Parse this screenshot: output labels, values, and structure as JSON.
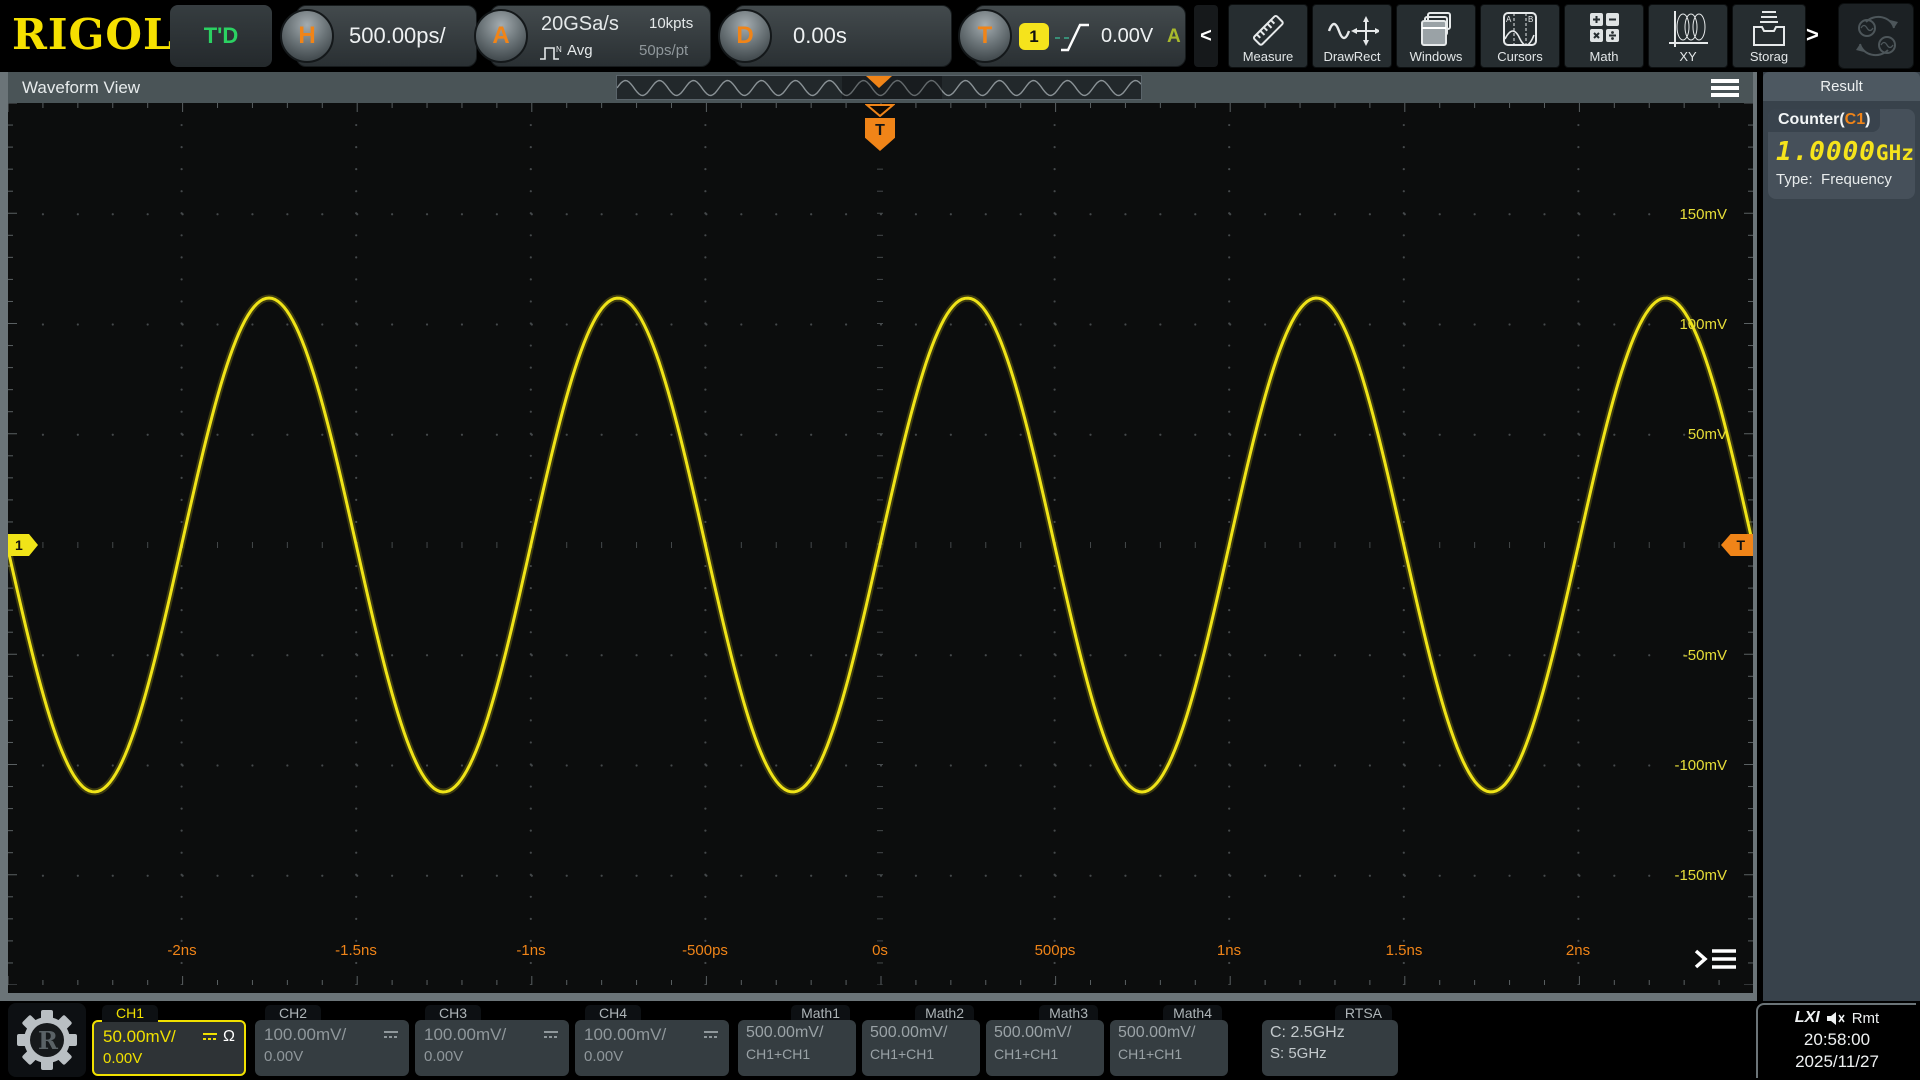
{
  "top_bar": {
    "logo": "RIGOL",
    "trigger_status": "T'D",
    "horizontal": {
      "knob": "H",
      "scale": "500.00ps/"
    },
    "acquire": {
      "knob": "A",
      "sample_rate": "20GSa/s",
      "mem_depth": "10kpts",
      "mode": "Avg",
      "resolution": "50ps/pt"
    },
    "delay": {
      "knob": "D",
      "value": "0.00s"
    },
    "trigger": {
      "knob": "T",
      "source": "1",
      "level": "0.00V",
      "sweep": "A"
    },
    "collapse_left": "<",
    "scroll_right": ">",
    "toolbar": [
      {
        "label": "Measure"
      },
      {
        "label": "DrawRect"
      },
      {
        "label": "Windows"
      },
      {
        "label": "Cursors"
      },
      {
        "label": "Math"
      },
      {
        "label": "XY"
      },
      {
        "label": "Storag"
      }
    ]
  },
  "waveform_view": {
    "title": "Waveform View",
    "channel_marker": "1",
    "trigger_marker": "T",
    "voltage_labels": [
      "150mV",
      "100mV",
      "50mV",
      "-50mV",
      "-100mV",
      "-150mV"
    ],
    "time_labels": [
      "-2ns",
      "-1.5ns",
      "-1ns",
      "-500ps",
      "0s",
      "500ps",
      "1ns",
      "1.5ns",
      "2ns"
    ]
  },
  "waveform": {
    "channel": "CH1",
    "shape": "sine",
    "frequency": "1GHz",
    "amplitude_mV": 112,
    "offset_mV": 0,
    "cycles_visible": 5,
    "color": "#f0e418"
  },
  "result_panel": {
    "title": "Result",
    "counter_label": "Counter(",
    "counter_source": "C1",
    "counter_label_close": ")",
    "value": "1.0000",
    "unit": "GHz",
    "type_label": "Type:",
    "type_value": "Frequency"
  },
  "channels": [
    {
      "name": "CH1",
      "scale": "50.00mV/",
      "offset": "0.00V",
      "impedance": "Ω",
      "active": true
    },
    {
      "name": "CH2",
      "scale": "100.00mV/",
      "offset": "0.00V",
      "active": false
    },
    {
      "name": "CH3",
      "scale": "100.00mV/",
      "offset": "0.00V",
      "active": false
    },
    {
      "name": "CH4",
      "scale": "100.00mV/",
      "offset": "0.00V",
      "active": false
    }
  ],
  "math": [
    {
      "name": "Math1",
      "scale": "500.00mV/",
      "expr": "CH1+CH1"
    },
    {
      "name": "Math2",
      "scale": "500.00mV/",
      "expr": "CH1+CH1"
    },
    {
      "name": "Math3",
      "scale": "500.00mV/",
      "expr": "CH1+CH1"
    },
    {
      "name": "Math4",
      "scale": "500.00mV/",
      "expr": "CH1+CH1"
    }
  ],
  "rtsa": {
    "name": "RTSA",
    "center": "C: 2.5GHz",
    "span": "S: 5GHz"
  },
  "status": {
    "lxi": "LXI",
    "rmt": "Rmt",
    "time": "20:58:00",
    "date": "2025/11/27"
  },
  "colors": {
    "accent_orange": "#f08418",
    "accent_yellow": "#f0e418",
    "trigd_green": "#2bd162"
  }
}
